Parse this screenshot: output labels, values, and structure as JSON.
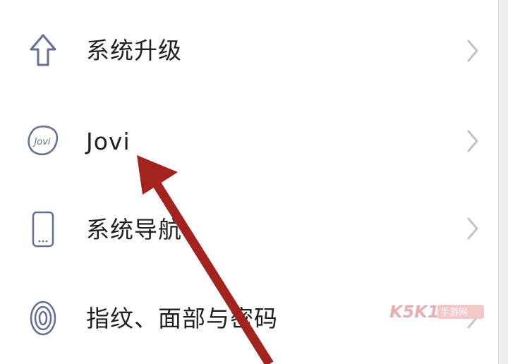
{
  "settings": {
    "items": [
      {
        "label": "系统升级",
        "icon": "upload-arrow-icon"
      },
      {
        "label": "Jovi",
        "icon": "jovi-logo-icon",
        "icon_text": "Jovi"
      },
      {
        "label": "系统导航",
        "icon": "phone-outline-icon"
      },
      {
        "label": "指纹、面部与密码",
        "icon": "fingerprint-icon"
      }
    ]
  },
  "colors": {
    "icon_stroke": "#5f6f9a",
    "text": "#1f1f1f",
    "chevron": "#c4c4c4",
    "annotation_arrow": "#a3221e",
    "watermark": "#e8b0b0"
  },
  "watermark": {
    "text": "K5K1手游网"
  }
}
